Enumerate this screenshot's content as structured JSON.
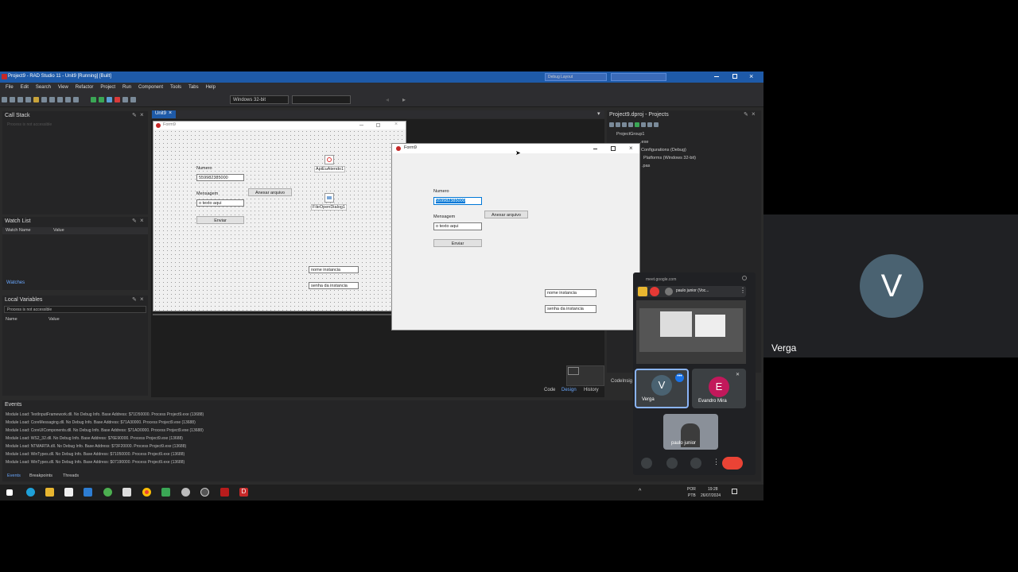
{
  "ide": {
    "title": "Project9 - RAD Studio 11 - Unit9 [Running] [Built]",
    "menu": [
      "File",
      "Edit",
      "Search",
      "View",
      "Refactor",
      "Project",
      "Run",
      "Component",
      "Tools",
      "Tabs",
      "Help"
    ],
    "layout_combo": "Debug Layout",
    "platform_combo": "Windows 32-bit",
    "tab": "Unit9",
    "panels": {
      "call_stack": "Call Stack",
      "call_stack_hint": "Process is not accessible",
      "watch_list": "Watch List",
      "watch_cols": [
        "Watch Name",
        "Value"
      ],
      "watches_tab": "Watches",
      "local_vars": "Local Variables",
      "local_hint": "Process is not accessible",
      "local_cols": [
        "Name",
        "Value"
      ],
      "projects": "Project9.dproj - Projects",
      "project_tree": [
        "ProjectGroup1",
        ".exe",
        "Configurations (Debug)",
        "Platforms (Windows 32-bit)",
        ".pas"
      ],
      "codein": "CodeInsig"
    },
    "view_tabs": [
      "Code",
      "Design",
      "History"
    ],
    "events": {
      "title": "Events",
      "lines": [
        "Module Load: TextInputFramework.dll. No Debug Info. Base Address: $71D50000. Process Project9.exe (13688)",
        "Module Load: CoreMessaging.dll. No Debug Info. Base Address: $71A30000. Process Project9.exe (13688)",
        "Module Load: CoreUIComponents.dll. No Debug Info. Base Address: $71AD0000. Process Project9.exe (13688)",
        "Module Load: WS2_32.dll. No Debug Info. Base Address: $76E90000. Process Project9.exe (13688)",
        "Module Load: NTMARTA.dll. No Debug Info. Base Address: $73F20000. Process Project9.exe (13688)",
        "Module Load: WinTypes.dll. No Debug Info. Base Address: $71050000. Process Project9.exe (13688)",
        "Module Load: WinTypes.dll. No Debug Info. Base Address: $07190000. Process Project9.exe (13688)"
      ],
      "tabs": [
        "Events",
        "Breakpoints",
        "Threads"
      ]
    }
  },
  "designer_form": {
    "title": "Form9",
    "numero_label": "Numero",
    "numero_value": "559982385000",
    "mensagem_label": "Mensagem",
    "mensagem_value": "o texto aqui",
    "anexar": "Anexar arquivo",
    "enviar": "Enviar",
    "comp1": "ApiEuAtendo1",
    "comp2": "FileOpenDialog1",
    "nome": "nome instancia",
    "senha": "senha da instancia"
  },
  "running_form": {
    "title": "Form9",
    "numero_label": "Numero",
    "numero_value": "559982385000",
    "mensagem_label": "Mensagem",
    "mensagem_value": "o texto aqui",
    "anexar": "Anexar arquivo",
    "enviar": "Enviar",
    "nome": "nome instancia",
    "senha": "senha da instancia"
  },
  "meet": {
    "url": "meet.google.com",
    "presenter": "paulo junior (Voc...",
    "tiles": [
      {
        "initial": "V",
        "name": "Verga",
        "color": "#4a6271"
      },
      {
        "initial": "E",
        "name": "Evandro Mira",
        "color": "#c2185b"
      }
    ],
    "camera_name": "paulo junior"
  },
  "stage": {
    "initial": "V",
    "name": "Verga"
  },
  "taskbar": {
    "lang": "POR",
    "lang2": "PTB",
    "time": "19:28",
    "date": "26/07/2024"
  }
}
